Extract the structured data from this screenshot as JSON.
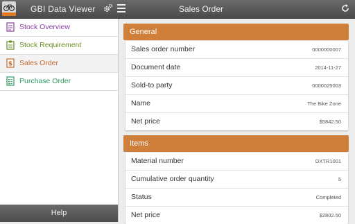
{
  "colors": {
    "accent": "#d07f3a",
    "topbar": "#555555",
    "stock_overview": "#8a3f9e",
    "stock_requirement": "#6b8e23",
    "sales_order": "#c06a2b",
    "purchase_order": "#2e9a60"
  },
  "app": {
    "title": "GBI Data Viewer",
    "logo_icon": "bike-logo-icon",
    "settings_icon": "settings-gear-icon",
    "menu_icon": "hamburger-menu-icon",
    "refresh_icon": "refresh-icon"
  },
  "page": {
    "title": "Sales Order"
  },
  "sidebar": {
    "items": [
      {
        "label": "Stock Overview",
        "icon": "document-icon",
        "active": false
      },
      {
        "label": "Stock Requirement",
        "icon": "clipboard-icon",
        "active": false
      },
      {
        "label": "Sales Order",
        "icon": "dollar-document-icon",
        "active": true
      },
      {
        "label": "Purchase Order",
        "icon": "list-document-icon",
        "active": false
      }
    ],
    "help_label": "Help"
  },
  "general": {
    "header": "General",
    "rows": [
      {
        "label": "Sales order number",
        "value": "0000000007"
      },
      {
        "label": "Document date",
        "value": "2014-11-27"
      },
      {
        "label": "Sold-to party",
        "value": "0000025003"
      },
      {
        "label": "Name",
        "value": "The Bike Zone"
      },
      {
        "label": "Net price",
        "value": "$5842.50"
      }
    ]
  },
  "items": {
    "header": "Items",
    "rows": [
      {
        "label": "Material number",
        "value": "DXTR1001"
      },
      {
        "label": "Cumulative order quantity",
        "value": "5"
      },
      {
        "label": "Status",
        "value": "Completed"
      },
      {
        "label": "Net price",
        "value": "$2802.50"
      }
    ]
  }
}
